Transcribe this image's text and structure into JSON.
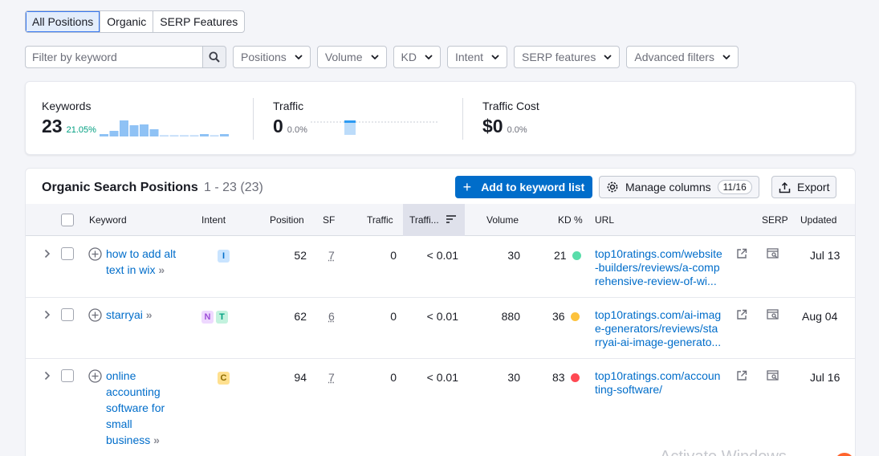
{
  "tabs": [
    "All Positions",
    "Organic",
    "SERP Features"
  ],
  "filters": {
    "search_placeholder": "Filter by keyword",
    "dropdowns": [
      "Positions",
      "Volume",
      "KD",
      "Intent",
      "SERP features",
      "Advanced filters"
    ]
  },
  "summary": {
    "keywords": {
      "label": "Keywords",
      "value": "23",
      "change": "21.05%"
    },
    "traffic": {
      "label": "Traffic",
      "value": "0",
      "change": "0.0%"
    },
    "traffic_cost": {
      "label": "Traffic Cost",
      "value": "$0",
      "change": "0.0%"
    },
    "keyword_bars": [
      0.15,
      0.35,
      1.0,
      0.7,
      0.75,
      0.45,
      0.08,
      0.08,
      0.08,
      0.08,
      0.15,
      0.08,
      0.15
    ],
    "traffic_bars": [
      0,
      0,
      0,
      0,
      0,
      0,
      1.0,
      0,
      0,
      0,
      0,
      0,
      0
    ]
  },
  "table": {
    "title": "Organic Search Positions",
    "count": "1 - 23 (23)",
    "add_button": "Add to keyword list",
    "manage_columns": "Manage columns",
    "columns_badge": "11/16",
    "export": "Export",
    "headers": {
      "keyword": "Keyword",
      "intent": "Intent",
      "position": "Position",
      "sf": "SF",
      "traffic": "Traffic",
      "traffic_pct": "Traffi...",
      "volume": "Volume",
      "kd": "KD %",
      "url": "URL",
      "serp": "SERP",
      "updated": "Updated"
    },
    "rows": [
      {
        "keyword_lines": [
          "how to add alt",
          "text in wix"
        ],
        "intents": [
          {
            "letter": "I",
            "bg": "#c9e4ff",
            "fg": "#006dca"
          }
        ],
        "position": "52",
        "sf": "7",
        "traffic": "0",
        "traffic_pct": "< 0.01",
        "volume": "30",
        "kd": "21",
        "kd_color": "#59ddaa",
        "url_lines": [
          "top10ratings.com/website",
          "-builders/reviews/a-comp",
          "rehensive-review-of-wi..."
        ],
        "updated": "Jul 13"
      },
      {
        "keyword_lines": [
          "starryai"
        ],
        "intents": [
          {
            "letter": "N",
            "bg": "#eed8ff",
            "fg": "#9d4ed8"
          },
          {
            "letter": "T",
            "bg": "#c3f2de",
            "fg": "#009f81"
          }
        ],
        "position": "62",
        "sf": "6",
        "traffic": "0",
        "traffic_pct": "< 0.01",
        "volume": "880",
        "kd": "36",
        "kd_color": "#fdc23c",
        "url_lines": [
          "top10ratings.com/ai-imag",
          "e-generators/reviews/sta",
          "rryai-ai-image-generato..."
        ],
        "updated": "Aug 04"
      },
      {
        "keyword_lines": [
          "online",
          "accounting",
          "software for",
          "small",
          "business"
        ],
        "intents": [
          {
            "letter": "C",
            "bg": "#ffe08f",
            "fg": "#8b6a00"
          }
        ],
        "position": "94",
        "sf": "7",
        "traffic": "0",
        "traffic_pct": "< 0.01",
        "volume": "30",
        "kd": "83",
        "kd_color": "#ff4953",
        "url_lines": [
          "top10ratings.com/accoun",
          "ting-software/"
        ],
        "updated": "Jul 16"
      }
    ]
  },
  "watermark": "Activate Windows",
  "colors": {
    "accent": "#006dca",
    "tab_active_border": "#3677f1",
    "bar": "#8fc2f5"
  }
}
